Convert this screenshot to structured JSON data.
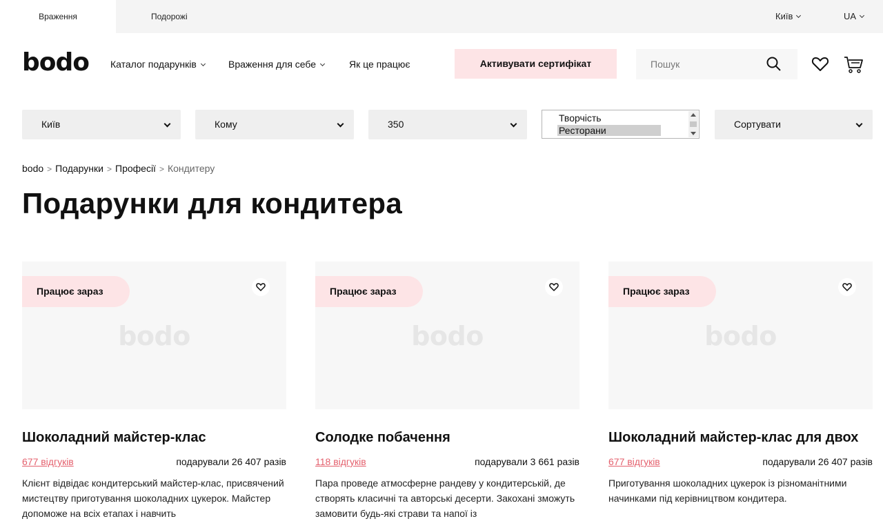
{
  "topbar": {
    "tab_experiences": "Враження",
    "tab_travel": "Подорожі",
    "city": "Київ",
    "lang": "UA"
  },
  "header": {
    "logo": "bodo",
    "nav_catalog": "Каталог подарунків",
    "nav_self": "Враження для себе",
    "nav_how": "Як це працює",
    "activate_label": "Активувати сертифікат",
    "search_placeholder": "Пошук",
    "icons": [
      "search-icon",
      "heart-icon",
      "cart-icon"
    ]
  },
  "filters": {
    "city": "Київ",
    "whom": "Кому",
    "price": "350",
    "list_options": [
      "Творчість",
      "Ресторани"
    ],
    "list_selected": "Ресторани",
    "sort": "Сортувати"
  },
  "breadcrumb": {
    "items": [
      "bodo",
      "Подарунки",
      "Професії"
    ],
    "current": "Кондитеру",
    "separator": ">"
  },
  "page_title": "Подарунки для кондитера",
  "cards": [
    {
      "badge": "Працює зараз",
      "image_placeholder": "bodo",
      "title": "Шоколадний майстер-клас",
      "reviews": "677 відгуків",
      "gifted": "подарували 26 407 разів",
      "description": "Клієнт відвідає кондитерський майстер-клас, присвячений мистецтву приготування шоколадних цукерок. Майстер допоможе на всіх етапах і навчить"
    },
    {
      "badge": "Працює зараз",
      "image_placeholder": "bodo",
      "title": "Солодке побачення",
      "reviews": "118 відгуків",
      "gifted": "подарували 3 661 разів",
      "description": "Пара проведе атмосферне рандеву у кондитерській, де створять класичні та авторські десерти. Закохані зможуть замовити будь-які страви та напої із"
    },
    {
      "badge": "Працює зараз",
      "image_placeholder": "bodo",
      "title": "Шоколадний майстер-клас для двох",
      "reviews": "677 відгуків",
      "gifted": "подарували 26 407 разів",
      "description": "Приготування шоколадних цукерок із різноманітними начинками під керівництвом кондитера."
    }
  ],
  "colors": {
    "accent_pink": "#fde4e6",
    "review_link": "#e4606d",
    "text": "#111111"
  }
}
